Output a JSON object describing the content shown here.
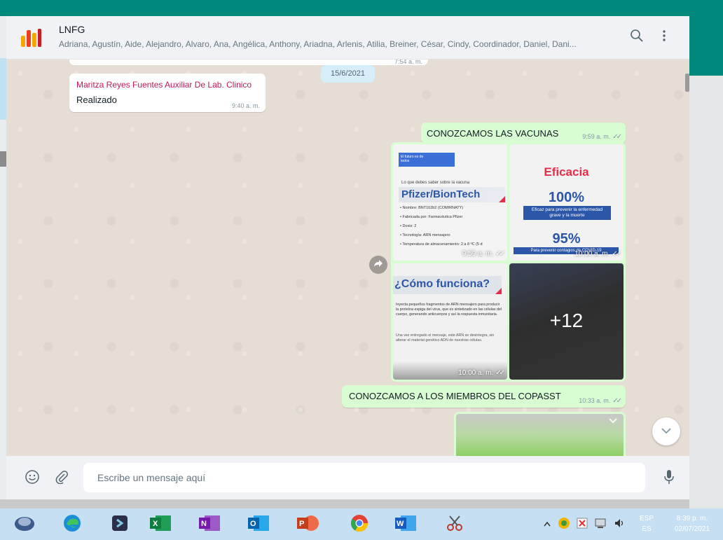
{
  "app": {
    "chat_title": "LNFG",
    "members": "Adriana, Agustín, Aide, Alejandro, Alvaro, Ana, Angélica, Anthony, Ariadna, Arlenis, Atilia, Breiner, César, Cindy, Coordinador, Daniel, Dani..."
  },
  "header_icons": [
    "search-icon",
    "menu-icon"
  ],
  "messages": {
    "prev_time": "7:54 a. m.",
    "date_chip": "15/6/2021",
    "msg1": {
      "sender": "Maritza Reyes Fuentes Auxiliar De Lab. Clinico",
      "text": "Realizado",
      "time": "9:40 a. m."
    },
    "msg2": {
      "text": "CONOZCAMOS LAS VACUNAS",
      "time": "9:59 a. m."
    },
    "gallery": {
      "tile1": {
        "logo_text": "El futuro es de todos",
        "intro": "Lo que debes saber sobre la vacuna",
        "vaccine": "Pfizer/BionTech",
        "details": [
          "• Nombre: BNT162b2 (COMIRNATY)",
          "• Fabricada por: Farmacéutica Pfizer",
          "• Dosis: 2",
          "• Tecnología: ARN mensajero",
          "• Temperatura de almacenamiento: 2 a 8 ºC (5 d"
        ],
        "time": "9:59 a. m."
      },
      "tile2": {
        "heading": "Eficacia",
        "pct1": "100%",
        "caption1": "Eficaz para prevenir la enfermedad grave y la muerte",
        "pct2": "95%",
        "caption2": "Para prevenir contagios de COVID-19",
        "time": "10:00 a. m."
      },
      "tile3": {
        "heading": "¿Cómo funciona?",
        "para1": "Inyecta pequeños fragmentos de ARN mensajero para producir la proteína espiga del virus, que es sintetizado en las células del cuerpo, generando anticuerpos y así la respuesta inmunitaria.",
        "para2": "Una vez entregado el mensaje, este ARN se desintegra, sin alterar el material genético ADN de nuestras células.",
        "time": "10:00 a. m."
      },
      "tile4": {
        "more": "+12"
      }
    },
    "msg3": {
      "text": "CONOZCAMOS A LOS MIEMBROS DEL COPASST",
      "time": "10:33 a. m."
    }
  },
  "compose": {
    "placeholder": "Escribe un mensaje aquí"
  },
  "taskbar": {
    "apps": [
      "app-icon",
      "edge-icon",
      "winrar-icon",
      "excel-icon",
      "onenote-icon",
      "outlook-icon",
      "powerpoint-icon",
      "chrome-icon",
      "word-icon",
      "snipping-tool-icon"
    ],
    "lang_top": "ESP",
    "lang_bottom": "ES",
    "time": "8:39 p. m.",
    "date": "02/07/2021"
  },
  "colors": {
    "accent": "#00897b",
    "outgoing_bubble": "#d9fdd3",
    "sender_name": "#c2185b",
    "vaccine_blue": "#2c56a8",
    "eficacia_red": "#e52d4a"
  }
}
